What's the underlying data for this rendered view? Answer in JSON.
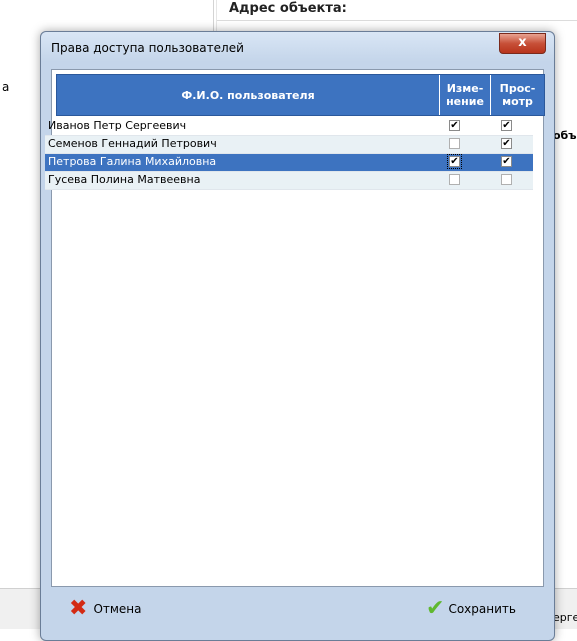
{
  "background": {
    "header": "Адрес объекта:",
    "left_label": "а",
    "right_label": "объ",
    "bottom_right": "ерге"
  },
  "dialog": {
    "title": "Права доступа пользователей",
    "close_label": "x",
    "columns": {
      "name": "Ф.И.О. пользователя",
      "edit_line1": "Изме-",
      "edit_line2": "нение",
      "view_line1": "Прос-",
      "view_line2": "мотр"
    },
    "rows": [
      {
        "name": "Иванов Петр Сергеевич",
        "edit": true,
        "view": true
      },
      {
        "name": "Семенов Геннадий Петрович",
        "edit": false,
        "view": true
      },
      {
        "name": "Петрова Галина Михайловна",
        "edit": true,
        "view": true,
        "selected": true
      },
      {
        "name": "Гусева Полина Матвеевна",
        "edit": false,
        "view": false
      }
    ],
    "cancel_label": "Отмена",
    "save_label": "Сохранить"
  },
  "colors": {
    "header_blue": "#3d73c0",
    "row_alt": "#e9f1f5",
    "cancel_icon": "#d32a14",
    "save_icon": "#5fb82f"
  },
  "icons": {
    "cancel": "x-icon",
    "save": "checkmark-icon",
    "close": "close-icon"
  }
}
